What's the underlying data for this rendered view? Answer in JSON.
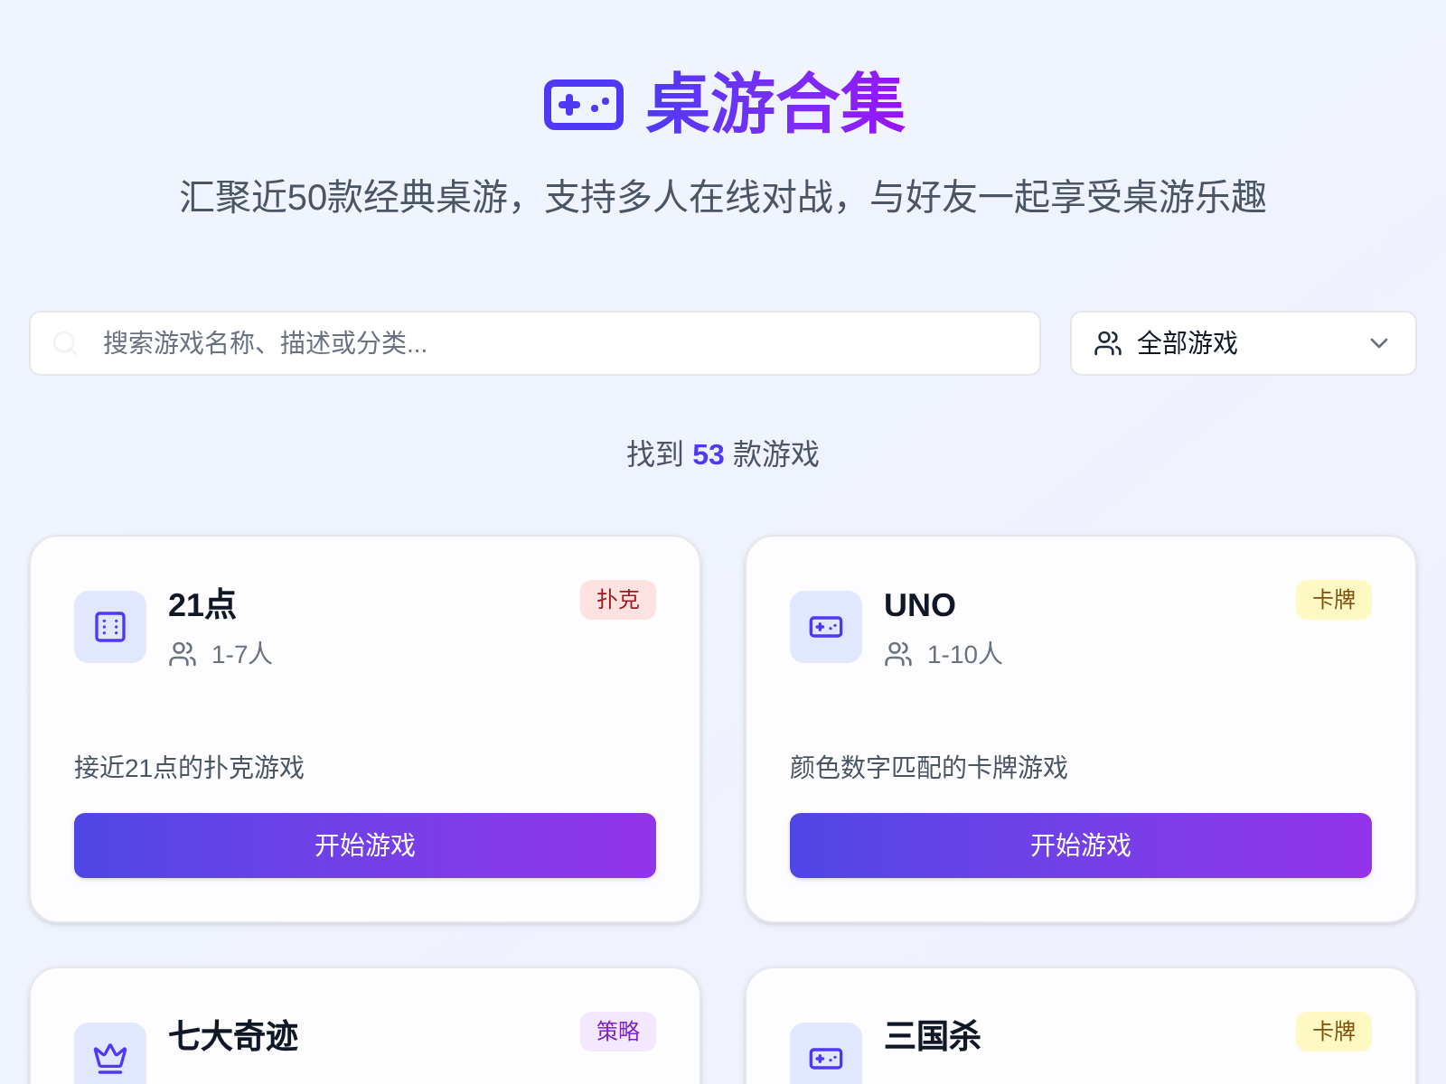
{
  "header": {
    "title": "桌游合集",
    "subtitle": "汇聚近50款经典桌游，支持多人在线对战，与好友一起享受桌游乐趣"
  },
  "search": {
    "placeholder": "搜索游戏名称、描述或分类..."
  },
  "filter": {
    "value": "全部游戏"
  },
  "result_count": "找到 **53** 款游戏",
  "games": [
    {
      "kind": "dice",
      "name": "21点",
      "players": "1-7人",
      "tag": {
        "label": "扑克",
        "color": "#fee2e2"
      },
      "description": "接近21点的扑克游戏",
      "button": "开始游戏"
    },
    {
      "kind": "gamepad",
      "name": "UNO",
      "players": "1-10人",
      "tag": {
        "label": "卡牌",
        "color": "#fef9c3"
      },
      "description": "颜色数字匹配的卡牌游戏",
      "button": "开始游戏"
    },
    {
      "kind": "crown",
      "name": "七大奇迹",
      "tag": {
        "label": "策略",
        "color": "#f3e8ff"
      }
    },
    {
      "kind": "gamepad",
      "name": "三国杀",
      "tag": {
        "label": "卡牌",
        "color": "#fef9c3"
      }
    }
  ]
}
